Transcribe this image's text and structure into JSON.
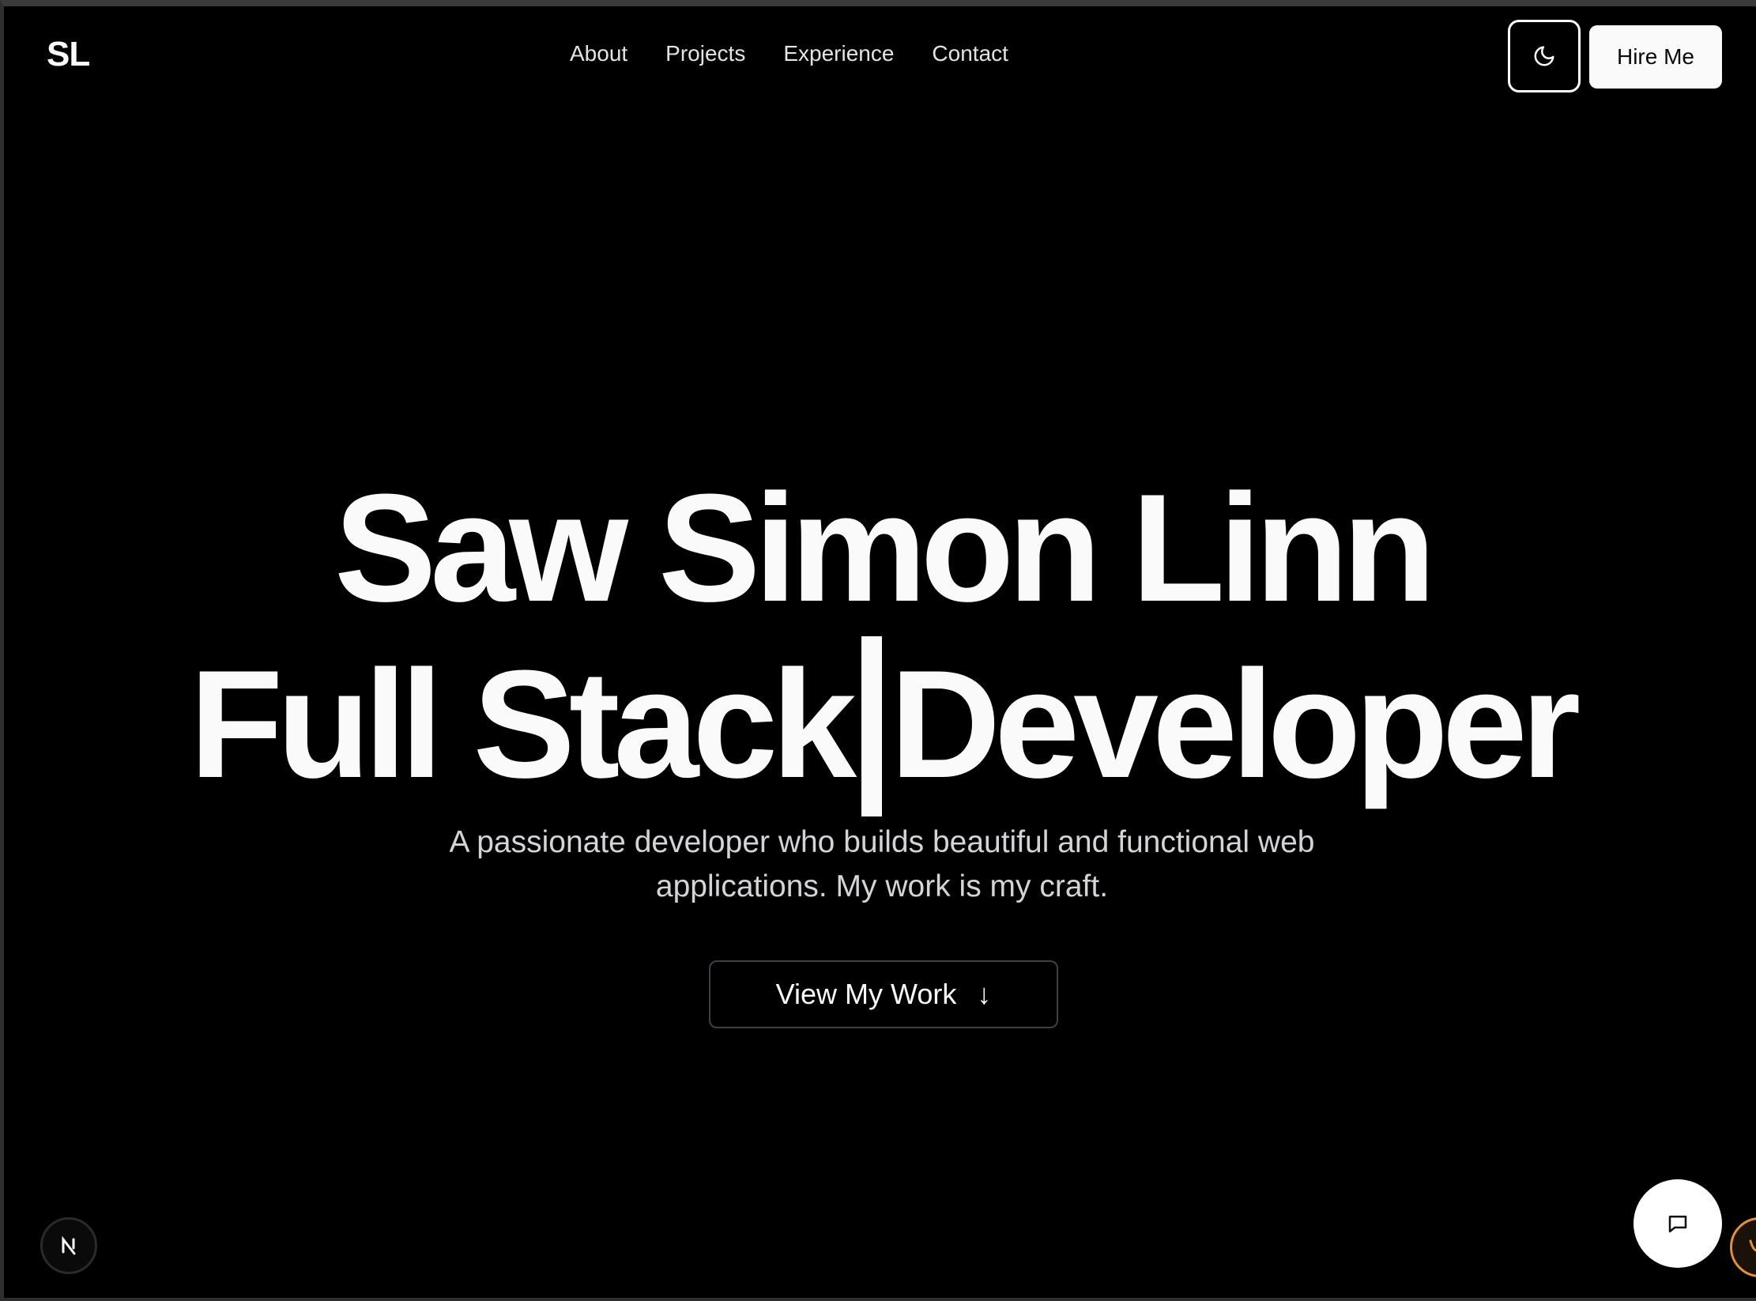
{
  "header": {
    "logo": "SL",
    "nav": [
      {
        "label": "About"
      },
      {
        "label": "Projects"
      },
      {
        "label": "Experience"
      },
      {
        "label": "Contact"
      }
    ],
    "theme_toggle_icon": "moon-icon",
    "hire_label": "Hire Me"
  },
  "hero": {
    "name": "Saw Simon Linn",
    "role_typed": "Full Stack",
    "role_rest": "Developer",
    "subtitle": "A passionate developer who builds beautiful and functional web applications. My work is my craft.",
    "cta_label": "View My Work",
    "cta_icon": "arrow-down-icon",
    "cta_arrow": "↓"
  },
  "widgets": {
    "next_badge": "N",
    "chat_icon": "chat-bubble-icon",
    "ext_icon": "extension-icon"
  },
  "colors": {
    "background": "#000000",
    "foreground": "#fafafa",
    "muted": "#d4d4d8",
    "accent": "#e0913a"
  }
}
